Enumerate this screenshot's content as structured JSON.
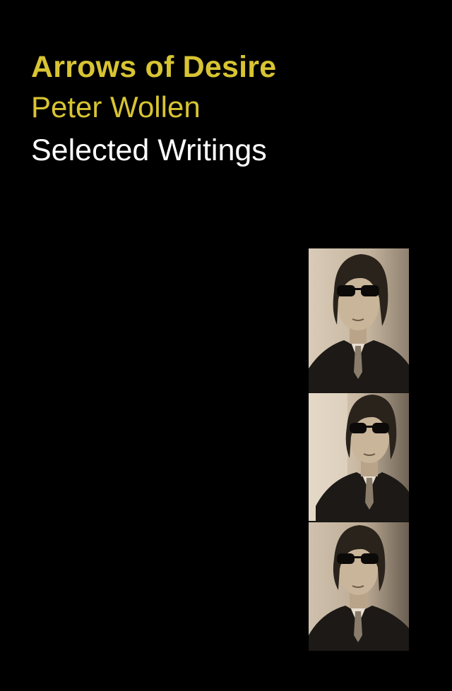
{
  "cover": {
    "title": "Arrows of Desire",
    "author": "Peter Wollen",
    "subtitle": "Selected Writings",
    "colors": {
      "background": "#000000",
      "title": "#d8c432",
      "author": "#d8c432",
      "subtitle": "#ffffff"
    }
  },
  "photo_strip": {
    "frames": 3,
    "style": "sepia photobooth portraits"
  }
}
